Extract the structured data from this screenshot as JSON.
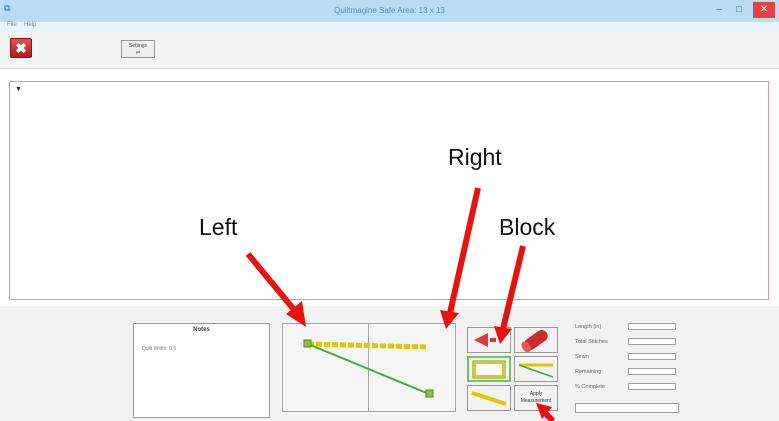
{
  "window": {
    "app_icon": "⧉",
    "title": "Quiltmagine    Safe Area: 13 x 13",
    "minimize": "–",
    "maximize": "□",
    "close": "✕"
  },
  "menu": {
    "items": [
      "File",
      "Help"
    ]
  },
  "toolbar": {
    "exit_glyph": "✖",
    "settings_label": "Settings",
    "settings_sub": "⇄"
  },
  "editor": {
    "cursor_mark": "▼"
  },
  "notes": {
    "title": "Notes",
    "text": "Quilt Width: 0.5"
  },
  "blocks": {
    "apply_label_1": "Apply",
    "apply_label_2": "Measurement"
  },
  "stats": {
    "labels": [
      "Length (in)",
      "Total Stitches",
      "Sewn",
      "Remaining",
      "% Complete"
    ],
    "values": [
      "",
      "",
      "",
      "",
      ""
    ]
  },
  "annotations": {
    "left": "Left",
    "right": "Right",
    "block": "Block"
  },
  "colors": {
    "titlebar": "#b7dcf3",
    "close": "#e04343",
    "editor_border": "#d89aa6",
    "stitch_yellow": "#e8c400",
    "stitch_green": "#3cae3c",
    "arrow_red": "#e81010"
  }
}
